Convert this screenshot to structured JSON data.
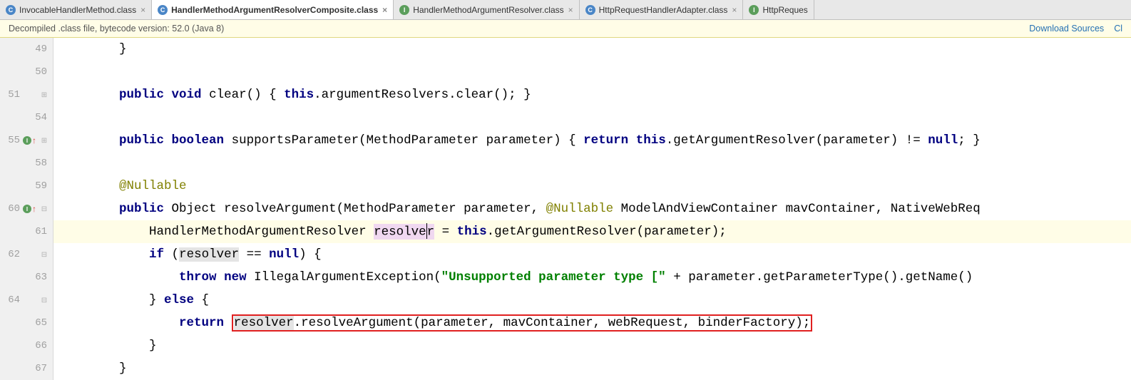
{
  "tabs": [
    {
      "icon": "C",
      "iconType": "class-icon",
      "label": "InvocableHandlerMethod.class",
      "active": false
    },
    {
      "icon": "C",
      "iconType": "class-icon",
      "label": "HandlerMethodArgumentResolverComposite.class",
      "active": true
    },
    {
      "icon": "I",
      "iconType": "interface-icon",
      "label": "HandlerMethodArgumentResolver.class",
      "active": false
    },
    {
      "icon": "C",
      "iconType": "class-icon",
      "label": "HttpRequestHandlerAdapter.class",
      "active": false
    },
    {
      "icon": "I",
      "iconType": "interface-icon",
      "label": "HttpReques",
      "active": false,
      "truncated": true
    }
  ],
  "infoBar": {
    "text": "Decompiled .class file, bytecode version: 52.0 (Java 8)",
    "link1": "Download Sources",
    "link2": "Cl"
  },
  "gutter": {
    "lines": [
      {
        "num": "49",
        "fold": ""
      },
      {
        "num": "50"
      },
      {
        "num": "51",
        "fold": "⊞"
      },
      {
        "num": "54"
      },
      {
        "num": "55",
        "mark": true,
        "fold": "⊞"
      },
      {
        "num": "58"
      },
      {
        "num": "59"
      },
      {
        "num": "60",
        "mark": true,
        "fold": "⊟"
      },
      {
        "num": "61"
      },
      {
        "num": "62",
        "fold": "⊟"
      },
      {
        "num": "63"
      },
      {
        "num": "64",
        "fold": "⊟"
      },
      {
        "num": "65"
      },
      {
        "num": "66",
        "fold": ""
      },
      {
        "num": "67",
        "fold": ""
      }
    ]
  },
  "code": {
    "l49": "        }",
    "l51_indent": "        ",
    "l51_kw1": "public",
    "l51_kw2": "void",
    "l51_sig": " clear() { ",
    "l51_kw3": "this",
    "l51_body": ".argumentResolvers.clear(); }",
    "l55_indent": "        ",
    "l55_kw1": "public",
    "l55_kw2": "boolean",
    "l55_sig": " supportsParameter(MethodParameter parameter) { ",
    "l55_kw3": "return",
    "l55_kw4": "this",
    "l55_body": ".getArgumentResolver(parameter) != ",
    "l55_kw5": "null",
    "l55_end": "; }",
    "l59_indent": "        ",
    "l59_ann": "@Nullable",
    "l60_indent": "        ",
    "l60_kw1": "public",
    "l60_ty": " Object resolveArgument(MethodParameter parameter, ",
    "l60_ann": "@Nullable",
    "l60_rest": " ModelAndViewContainer mavContainer, NativeWebReq",
    "l61_indent": "            HandlerMethodArgumentResolver ",
    "l61_var_a": "resolve",
    "l61_var_b": "r",
    "l61_mid": " = ",
    "l61_kw": "this",
    "l61_rest": ".getArgumentResolver(parameter);",
    "l62_indent": "            ",
    "l62_kw1": "if",
    "l62_p1": " (",
    "l62_var": "resolver",
    "l62_mid": " == ",
    "l62_kw2": "null",
    "l62_end": ") {",
    "l63_indent": "                ",
    "l63_kw1": "throw",
    "l63_kw2": "new",
    "l63_mid": " IllegalArgumentException(",
    "l63_str": "\"Unsupported parameter type [\"",
    "l63_rest": " + parameter.getParameterType().getName() ",
    "l64_indent": "            } ",
    "l64_kw": "else",
    "l64_end": " {",
    "l65_indent": "                ",
    "l65_kw": "return",
    "l65_sp": " ",
    "l65_var": "resolver",
    "l65_rest": ".resolveArgument(parameter, mavContainer, webRequest, binderFactory);",
    "l66": "            }",
    "l67": "        }"
  }
}
